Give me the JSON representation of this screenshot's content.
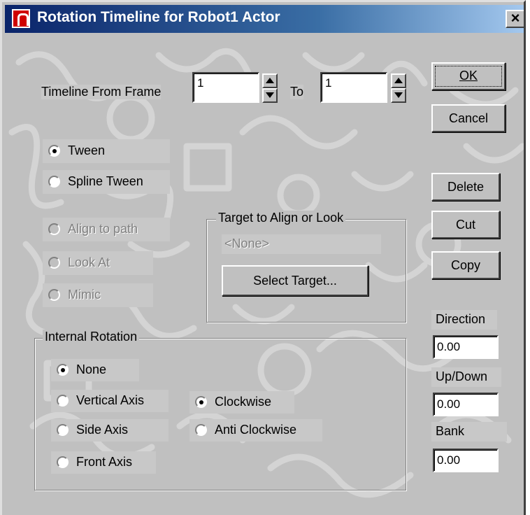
{
  "window": {
    "title": "Rotation Timeline for Robot1 Actor",
    "close_symbol": "×"
  },
  "timeline": {
    "from_label": "Timeline From Frame",
    "from_value": "1",
    "to_label": "To",
    "to_value": "1"
  },
  "buttons": {
    "ok": "OK",
    "cancel": "Cancel",
    "delete": "Delete",
    "cut": "Cut",
    "copy": "Copy",
    "select_target": "Select Target..."
  },
  "interpolation": {
    "tween": "Tween",
    "spline_tween": "Spline Tween",
    "selected": "tween"
  },
  "alignment": {
    "align_to_path": "Align to path",
    "look_at": "Look At",
    "mimic": "Mimic"
  },
  "target_group": {
    "title": "Target to Align or Look",
    "value": "<None>"
  },
  "internal_rotation": {
    "title": "Internal Rotation",
    "none": "None",
    "vertical": "Vertical Axis",
    "side": "Side Axis",
    "front": "Front Axis",
    "clockwise": "Clockwise",
    "anticlockwise": "Anti Clockwise",
    "axis_selected": "none",
    "direction_selected": "clockwise"
  },
  "orientation": {
    "direction_label": "Direction",
    "direction_value": "0.00",
    "updown_label": "Up/Down",
    "updown_value": "0.00",
    "bank_label": "Bank",
    "bank_value": "0.00"
  },
  "colors": {
    "face": "#c0c0c0",
    "title_start": "#0a246a",
    "title_end": "#a6caf0"
  }
}
